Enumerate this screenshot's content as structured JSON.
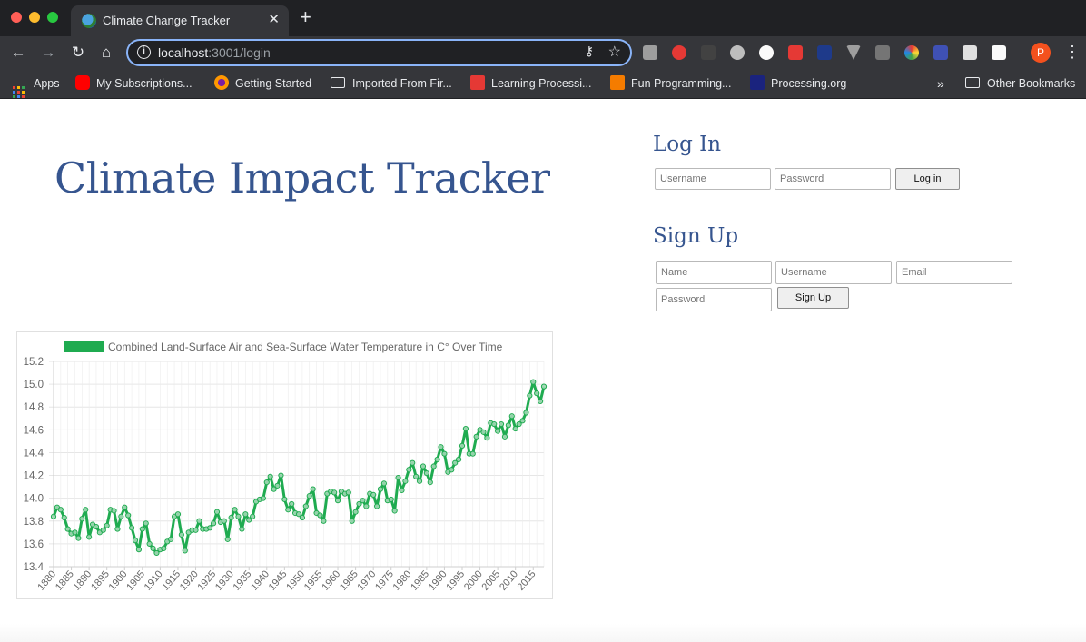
{
  "browser": {
    "tab_title": "Climate Change Tracker",
    "url_host": "localhost",
    "url_rest": ":3001/login",
    "bookmarks": [
      "Apps",
      "My Subscriptions...",
      "Getting Started",
      "Imported From Fir...",
      "Learning Processi...",
      "Fun Programming...",
      "Processing.org"
    ],
    "overflow": "»",
    "other_bookmarks": "Other Bookmarks",
    "profile_initial": "P"
  },
  "page": {
    "title": "Climate Impact Tracker",
    "login": {
      "heading": "Log In",
      "username_placeholder": "Username",
      "password_placeholder": "Password",
      "button": "Log in"
    },
    "signup": {
      "heading": "Sign Up",
      "name_placeholder": "Name",
      "username_placeholder": "Username",
      "email_placeholder": "Email",
      "password_placeholder": "Password",
      "button": "Sign Up"
    }
  },
  "chart_data": {
    "type": "line",
    "series_name": "Combined Land-Surface Air and Sea-Surface Water Temperature in C° Over Time",
    "color": "#1fab50",
    "legend_position": "top",
    "grid": true,
    "ylim": [
      13.4,
      15.2
    ],
    "yticks": [
      13.4,
      13.6,
      13.8,
      14.0,
      14.2,
      14.4,
      14.6,
      14.8,
      15.0,
      15.2
    ],
    "xticks": [
      1880,
      1885,
      1890,
      1895,
      1900,
      1905,
      1910,
      1915,
      1920,
      1925,
      1930,
      1935,
      1940,
      1945,
      1950,
      1955,
      1960,
      1965,
      1970,
      1975,
      1980,
      1985,
      1990,
      1995,
      2000,
      2005,
      2010,
      2015
    ],
    "x_start": 1880,
    "x_end": 2018,
    "values": [
      13.84,
      13.92,
      13.9,
      13.83,
      13.73,
      13.69,
      13.7,
      13.65,
      13.82,
      13.9,
      13.66,
      13.77,
      13.75,
      13.7,
      13.72,
      13.76,
      13.9,
      13.89,
      13.73,
      13.84,
      13.92,
      13.85,
      13.74,
      13.63,
      13.55,
      13.73,
      13.78,
      13.6,
      13.56,
      13.52,
      13.55,
      13.56,
      13.62,
      13.64,
      13.84,
      13.86,
      13.68,
      13.54,
      13.7,
      13.72,
      13.72,
      13.8,
      13.73,
      13.73,
      13.74,
      13.78,
      13.88,
      13.79,
      13.8,
      13.64,
      13.83,
      13.9,
      13.84,
      13.73,
      13.86,
      13.81,
      13.84,
      13.97,
      13.99,
      14.0,
      14.14,
      14.19,
      14.08,
      14.11,
      14.2,
      13.99,
      13.9,
      13.95,
      13.87,
      13.86,
      13.83,
      13.93,
      14.02,
      14.08,
      13.87,
      13.85,
      13.8,
      14.04,
      14.06,
      14.05,
      13.98,
      14.06,
      14.04,
      14.05,
      13.8,
      13.88,
      13.95,
      13.98,
      13.93,
      14.04,
      14.03,
      13.93,
      14.08,
      14.13,
      13.98,
      13.99,
      13.89,
      14.18,
      14.07,
      14.15,
      14.25,
      14.31,
      14.19,
      14.15,
      14.28,
      14.22,
      14.14,
      14.28,
      14.34,
      14.45,
      14.39,
      14.23,
      14.25,
      14.31,
      14.34,
      14.46,
      14.61,
      14.39,
      14.39,
      14.54,
      14.6,
      14.58,
      14.53,
      14.66,
      14.65,
      14.59,
      14.65,
      14.54,
      14.64,
      14.72,
      14.61,
      14.65,
      14.68,
      14.75,
      14.9,
      15.02,
      14.92,
      14.85,
      14.98
    ]
  }
}
